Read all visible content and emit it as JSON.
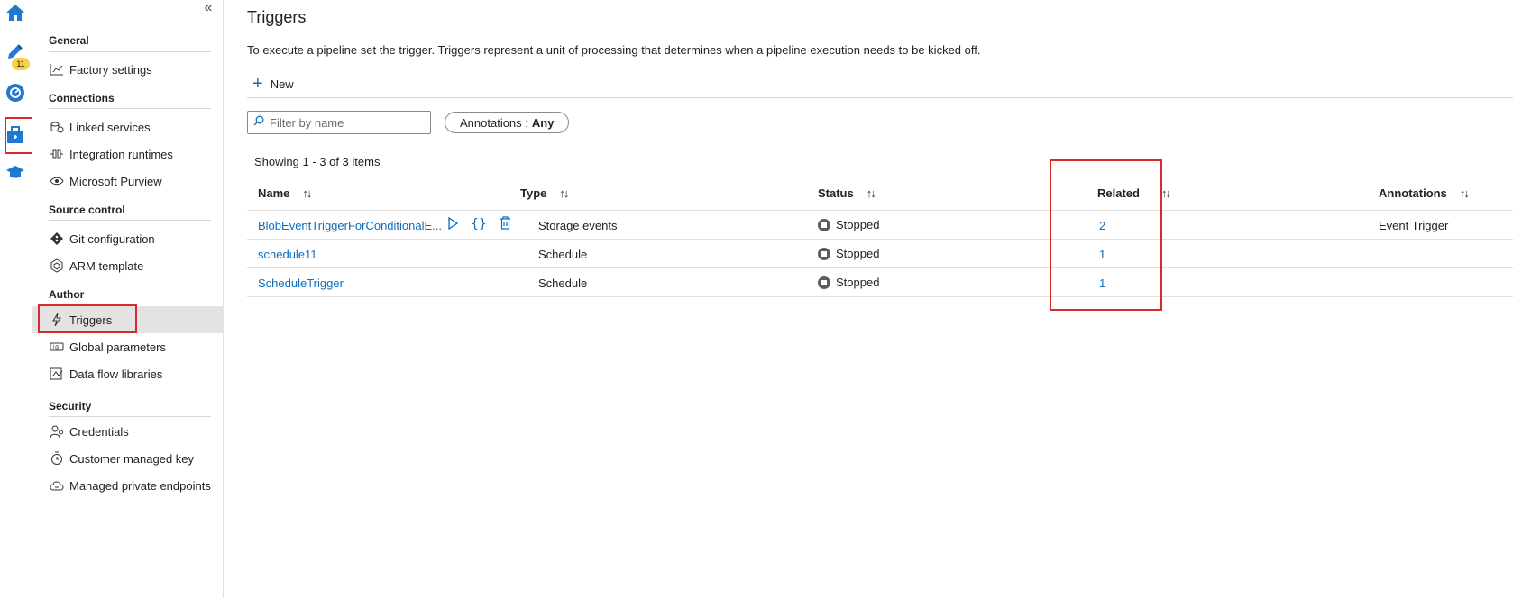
{
  "rail": {
    "badge": "11"
  },
  "nav": {
    "collapse_glyph": "«",
    "groups": [
      {
        "title": "General",
        "items": [
          {
            "label": "Factory settings",
            "icon": "chart-settings-icon"
          }
        ]
      },
      {
        "title": "Connections",
        "items": [
          {
            "label": "Linked services",
            "icon": "linked-services-icon"
          },
          {
            "label": "Integration runtimes",
            "icon": "integration-runtimes-icon"
          },
          {
            "label": "Microsoft Purview",
            "icon": "eye-icon"
          }
        ]
      },
      {
        "title": "Source control",
        "items": [
          {
            "label": "Git configuration",
            "icon": "git-icon"
          },
          {
            "label": "ARM template",
            "icon": "arm-template-icon"
          }
        ]
      },
      {
        "title": "Author",
        "items": [
          {
            "label": "Triggers",
            "icon": "lightning-icon",
            "active": true
          },
          {
            "label": "Global parameters",
            "icon": "parameters-icon"
          },
          {
            "label": "Data flow libraries",
            "icon": "library-icon"
          }
        ]
      },
      {
        "title": "Security",
        "items": [
          {
            "label": "Credentials",
            "icon": "credentials-icon"
          },
          {
            "label": "Customer managed key",
            "icon": "key-icon"
          },
          {
            "label": "Managed private endpoints",
            "icon": "cloud-endpoint-icon"
          }
        ]
      }
    ]
  },
  "main": {
    "title": "Triggers",
    "description": "To execute a pipeline set the trigger. Triggers represent a unit of processing that determines when a pipeline execution needs to be kicked off.",
    "new_label": "New",
    "filter_placeholder": "Filter by name",
    "annotations_label": "Annotations :",
    "annotations_value": "Any",
    "showing": "Showing 1 - 3 of 3 items",
    "columns": {
      "name": "Name",
      "type": "Type",
      "status": "Status",
      "related": "Related",
      "annotations": "Annotations"
    },
    "rows": [
      {
        "name": "BlobEventTriggerForConditionalE...",
        "type": "Storage events",
        "status": "Stopped",
        "related": "2",
        "annotations": "Event Trigger"
      },
      {
        "name": "schedule11",
        "type": "Schedule",
        "status": "Stopped",
        "related": "1",
        "annotations": ""
      },
      {
        "name": "ScheduleTrigger",
        "type": "Schedule",
        "status": "Stopped",
        "related": "1",
        "annotations": ""
      }
    ]
  },
  "colors": {
    "accent": "#0f6cbd",
    "highlight": "#d92a2a",
    "active_nav": "#e3e3e3",
    "badge": "#f7d046"
  }
}
